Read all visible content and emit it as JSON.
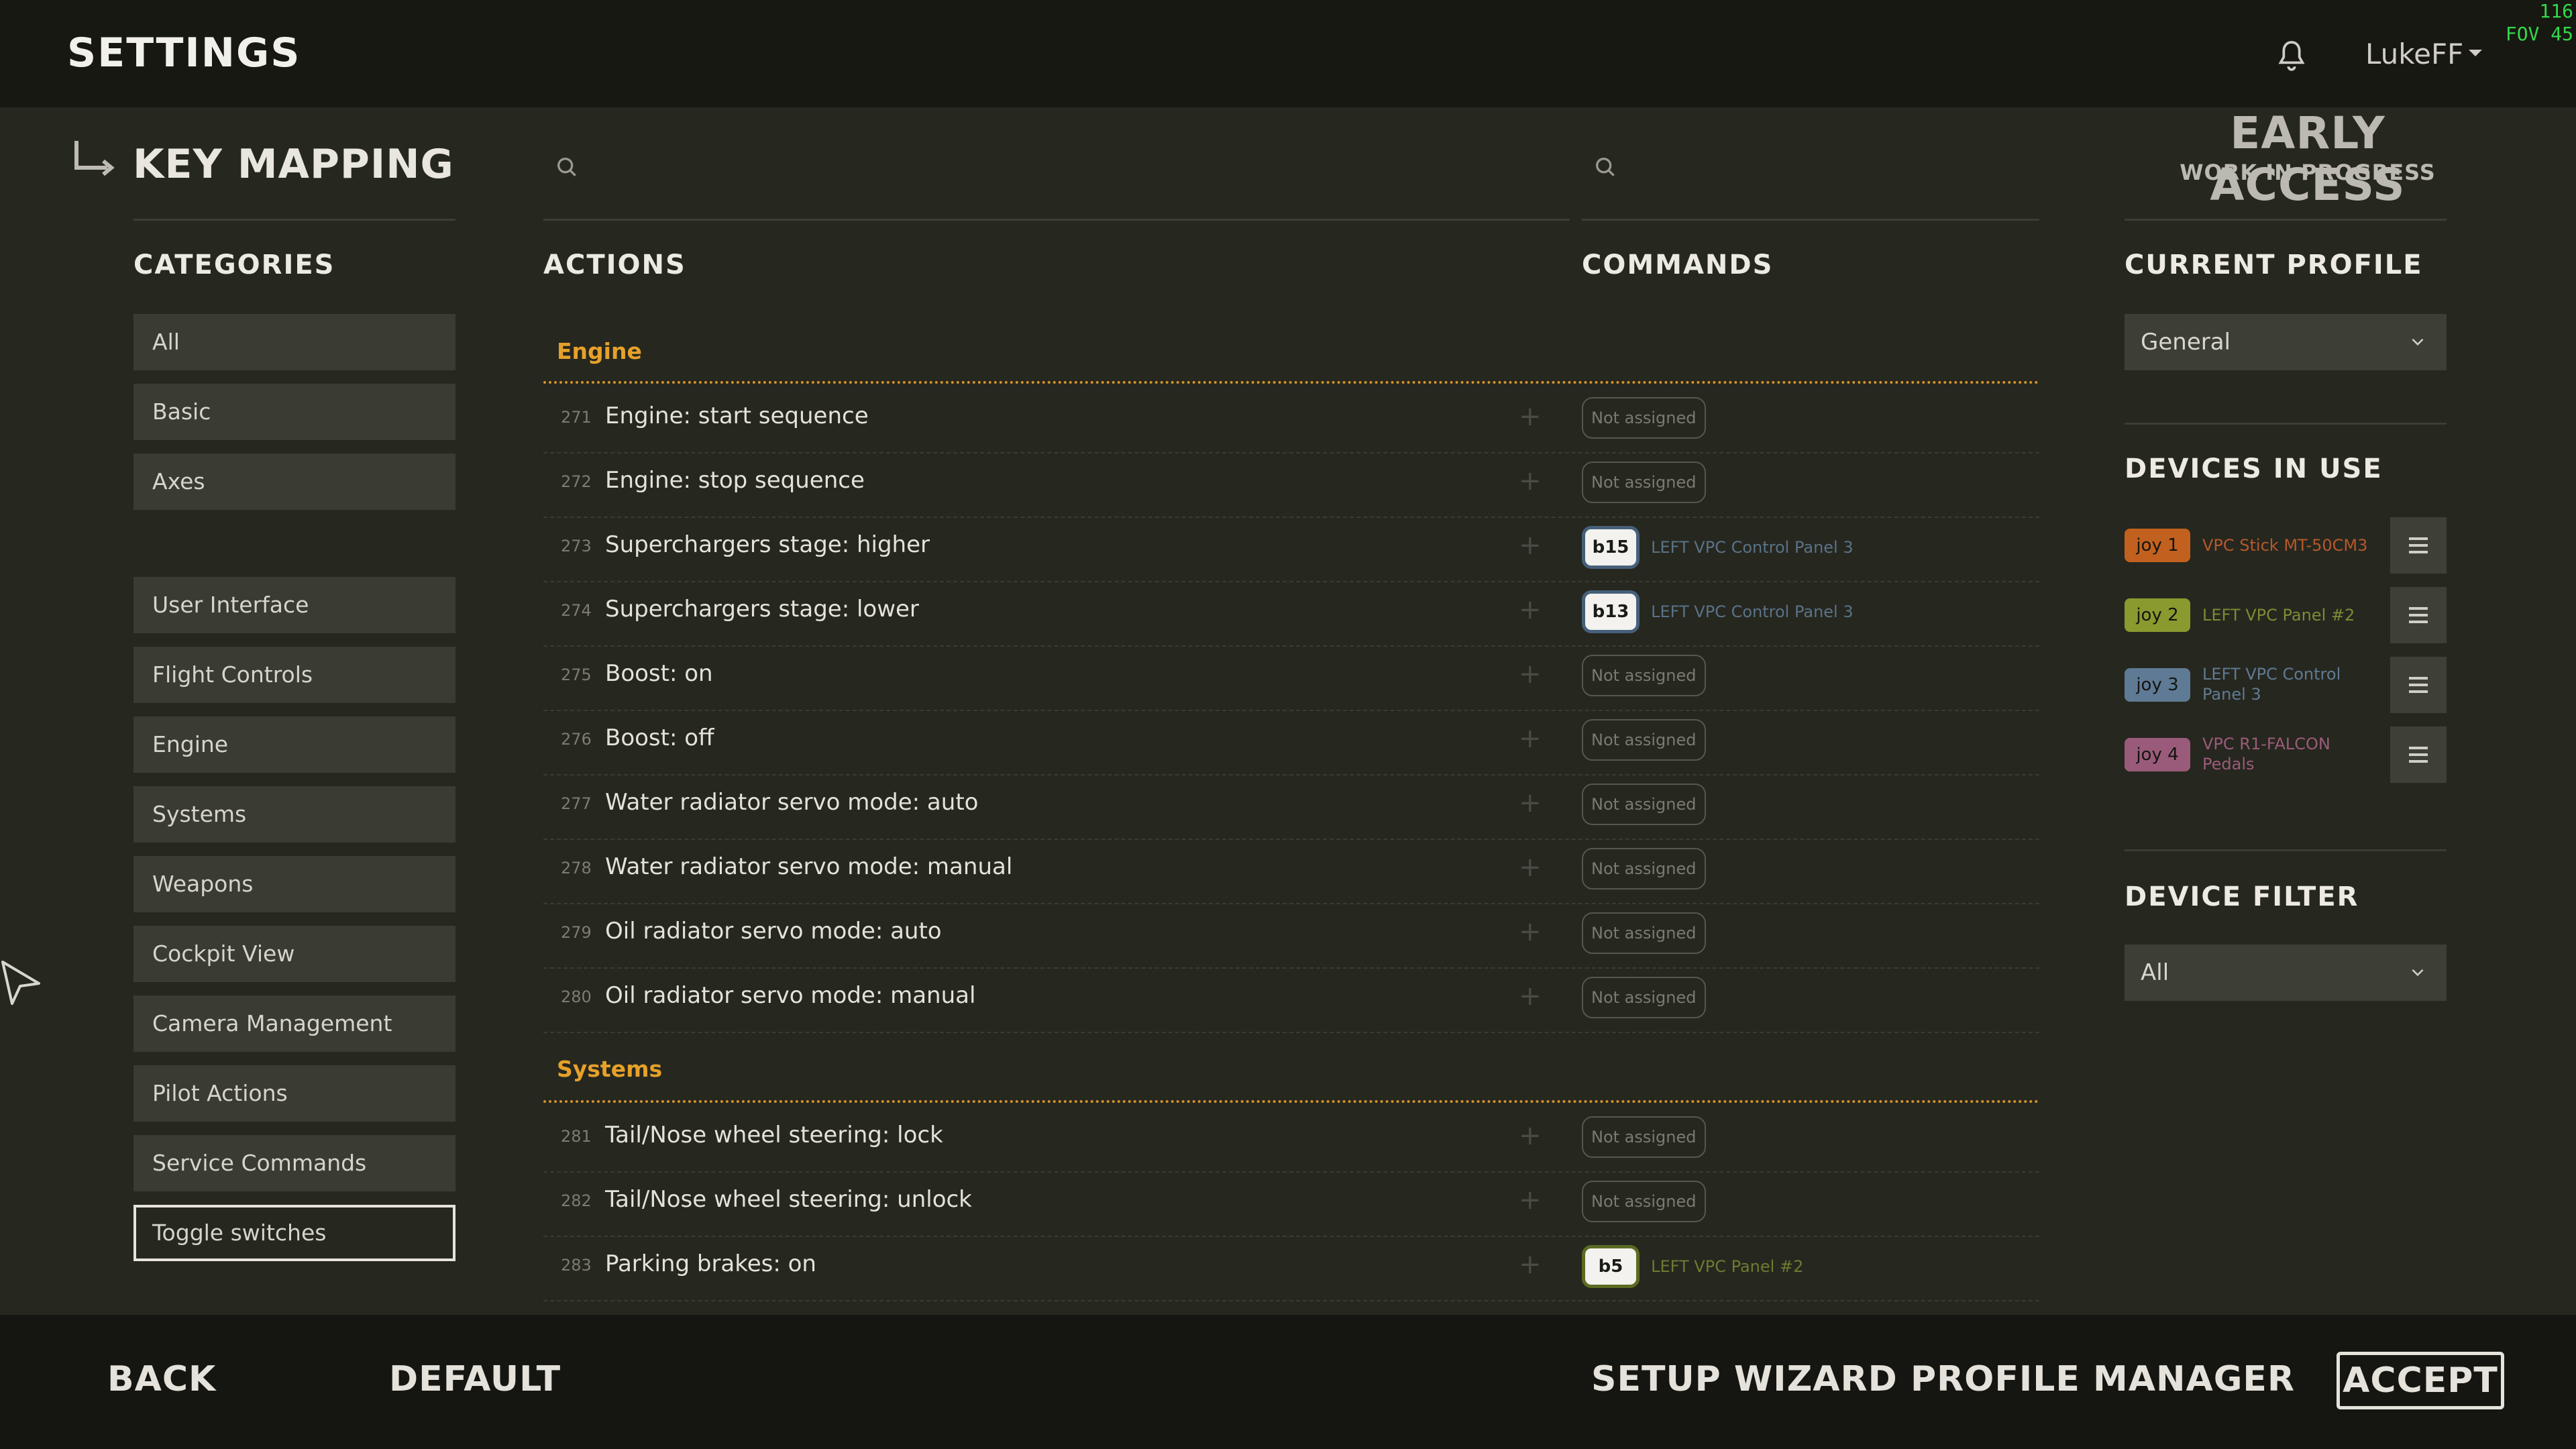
{
  "header": {
    "title": "SETTINGS",
    "username": "LukeFF",
    "fps_line1": "116",
    "fps_line2": "FOV 45",
    "icons": [
      "bell-icon",
      "chevron-down-icon"
    ]
  },
  "page": {
    "section_title": "KEY MAPPING",
    "early_access_title": "EARLY ACCESS",
    "early_access_subtitle": "WORK IN PROGRESS"
  },
  "columns": {
    "categories": "CATEGORIES",
    "actions": "ACTIONS",
    "commands": "COMMANDS",
    "current_profile": "CURRENT PROFILE",
    "devices_in_use": "DEVICES IN USE",
    "device_filter": "DEVICE FILTER"
  },
  "categories": [
    "All",
    "Basic",
    "Axes",
    "User Interface",
    "Flight Controls",
    "Engine",
    "Systems",
    "Weapons",
    "Cockpit View",
    "Camera Management",
    "Pilot Actions",
    "Service Commands",
    "Toggle switches"
  ],
  "active_category": "Toggle switches",
  "groups": {
    "engine": "Engine",
    "systems": "Systems"
  },
  "actions": [
    {
      "num": "271",
      "label": "Engine: start sequence",
      "command": "Not assigned"
    },
    {
      "num": "272",
      "label": "Engine: stop sequence",
      "command": "Not assigned"
    },
    {
      "num": "273",
      "label": "Superchargers stage: higher",
      "key": "b15",
      "device": "LEFT VPC Control Panel 3"
    },
    {
      "num": "274",
      "label": "Superchargers stage: lower",
      "key": "b13",
      "device": "LEFT VPC Control Panel 3"
    },
    {
      "num": "275",
      "label": "Boost: on",
      "command": "Not assigned"
    },
    {
      "num": "276",
      "label": "Boost: off",
      "command": "Not assigned"
    },
    {
      "num": "277",
      "label": "Water radiator servo mode: auto",
      "command": "Not assigned"
    },
    {
      "num": "278",
      "label": "Water radiator servo mode: manual",
      "command": "Not assigned"
    },
    {
      "num": "279",
      "label": "Oil radiator servo mode: auto",
      "command": "Not assigned"
    },
    {
      "num": "280",
      "label": "Oil radiator servo mode: manual",
      "command": "Not assigned"
    },
    {
      "num": "281",
      "label": "Tail/Nose wheel steering: lock",
      "command": "Not assigned"
    },
    {
      "num": "282",
      "label": "Tail/Nose wheel steering: unlock",
      "command": "Not assigned"
    },
    {
      "num": "283",
      "label": "Parking brakes: on",
      "key": "b5",
      "device": "LEFT VPC Panel #2"
    }
  ],
  "profile": {
    "selected": "General"
  },
  "devices": [
    {
      "joy": "joy 1",
      "name_line1": "VPC Stick MT-50CM3",
      "name_line2": "",
      "badge_color": "#c2611f",
      "text_color": "#b5592a"
    },
    {
      "joy": "joy 2",
      "name_line1": "LEFT VPC Panel #2",
      "name_line2": "",
      "badge_color": "#8a9a2e",
      "text_color": "#7f8a35"
    },
    {
      "joy": "joy 3",
      "name_line1": "LEFT VPC Control",
      "name_line2": "Panel 3",
      "badge_color": "#5f7a94",
      "text_color": "#5f7a94"
    },
    {
      "joy": "joy 4",
      "name_line1": "VPC R1-FALCON",
      "name_line2": "Pedals",
      "badge_color": "#9a5b7a",
      "text_color": "#9a5b7a"
    }
  ],
  "device_filter": {
    "selected": "All"
  },
  "footer": {
    "back": "BACK",
    "default": "DEFAULT",
    "setup_wizard": "SETUP WIZARD",
    "profile_manager": "PROFILE MANAGER",
    "accept": "ACCEPT"
  }
}
